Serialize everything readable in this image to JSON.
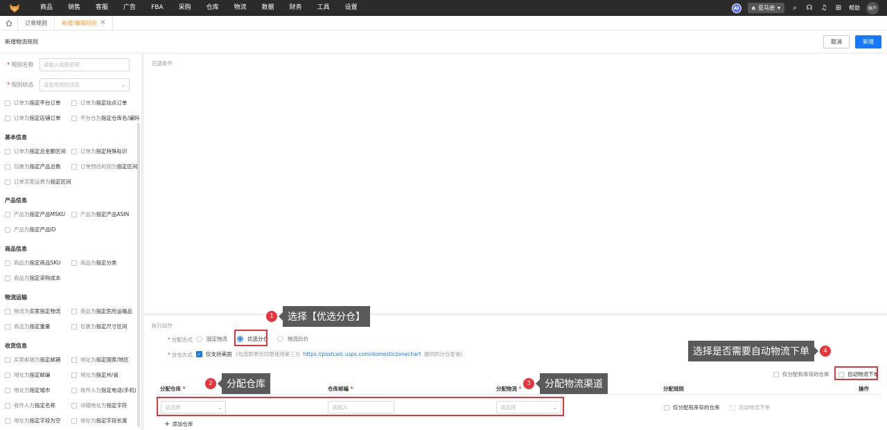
{
  "nav": {
    "items": [
      "商品",
      "销售",
      "客服",
      "广告",
      "FBA",
      "采购",
      "仓库",
      "物流",
      "数据",
      "财务",
      "工具",
      "设置"
    ],
    "ai_label": "AI",
    "store": "亚马逊",
    "help": "帮助",
    "account": "账户"
  },
  "tabs": {
    "tab1": "订单规则",
    "tab2": "新增/编辑规则"
  },
  "header": {
    "title": "新增物流规则",
    "cancel": "取消",
    "submit": "新增"
  },
  "sidebar": {
    "rule_name_label": "规则名称",
    "rule_name_placeholder": "请输入规则名称",
    "rule_status_label": "规则状态",
    "rule_status_placeholder": "请选择规则状态",
    "top_conditions": [
      {
        "pre": "订单为",
        "hl": "指定平台订单"
      },
      {
        "pre": "订单为",
        "hl": "指定站点订单"
      },
      {
        "pre": "订单为",
        "hl": "指定店铺订单"
      },
      {
        "pre": "平台仓为",
        "hl": "指定仓库名/编码"
      }
    ],
    "sections": [
      {
        "title": "基本信息",
        "items": [
          {
            "pre": "订单为",
            "hl": "指定总金额区间"
          },
          {
            "pre": "订单为",
            "hl": "指定特殊标识"
          },
          {
            "pre": "包裹为",
            "hl": "指定产品总数"
          },
          {
            "pre": "订单预估利润为",
            "hl": "指定区间"
          },
          {
            "pre": "订单买家运费为",
            "hl": "指定区间"
          }
        ]
      },
      {
        "title": "产品信息",
        "items": [
          {
            "pre": "产品为",
            "hl": "指定产品MSKU"
          },
          {
            "pre": "产品为",
            "hl": "指定产品ASIN"
          },
          {
            "pre": "产品为",
            "hl": "指定产品ID"
          }
        ]
      },
      {
        "title": "商品信息",
        "items": [
          {
            "pre": "商品为",
            "hl": "指定商品SKU"
          },
          {
            "pre": "商品为",
            "hl": "指定分类"
          },
          {
            "pre": "商品为",
            "hl": "指定采购成本"
          }
        ]
      },
      {
        "title": "物流运输",
        "items": [
          {
            "pre": "物流为",
            "hl": "买家指定物流"
          },
          {
            "pre": "商品为",
            "hl": "指定危险运输品"
          },
          {
            "pre": "商品为",
            "hl": "指定重量"
          },
          {
            "pre": "包裹为",
            "hl": "指定尺寸区间"
          }
        ]
      },
      {
        "title": "收货信息",
        "items": [
          {
            "pre": "买家邮箱为",
            "hl": "指定邮箱"
          },
          {
            "pre": "地址为",
            "hl": "指定国家/地区"
          },
          {
            "pre": "地址为",
            "hl": "指定邮编"
          },
          {
            "pre": "地址为",
            "hl": "指定州/省"
          },
          {
            "pre": "地址为",
            "hl": "指定城市"
          },
          {
            "pre": "收件人为",
            "hl": "指定电话(手机)"
          },
          {
            "pre": "收件人为",
            "hl": "指定名称"
          },
          {
            "pre": "详细地址为",
            "hl": "指定字符"
          },
          {
            "pre": "地址为",
            "hl": "指定字段为空"
          },
          {
            "pre": "地址为",
            "hl": "指定字段长度"
          }
        ]
      }
    ]
  },
  "main": {
    "selected_conditions": "已选条件",
    "exec_title": "执行动作",
    "alloc_mode_label": "分配方式",
    "alloc_options": [
      "固定物流",
      "优选分仓",
      "物流比价"
    ],
    "split_mode_label": "分仓方式",
    "split_option": "仅支持美国",
    "split_note_pre": "(勾选即表示同意使用第三方",
    "split_link": "https://postcalc.usps.com/domesticzonechart",
    "split_note_post": "提供的分仓查询)",
    "only_stock_label": "仅分配有库存的仓库",
    "auto_order_label": "自动物流下单",
    "columns": [
      "分配仓库",
      "仓库邮编",
      "分配物流",
      "分配规则",
      "操作"
    ],
    "row": {
      "warehouse_placeholder": "请选择",
      "zip_placeholder": "请输入",
      "logistics_placeholder": "请选择",
      "only_stock": "仅分配有库存的仓库",
      "auto_order": "自动物流下单"
    },
    "add_warehouse": "添加仓库"
  },
  "callouts": [
    {
      "num": "1",
      "text": "选择【优选分仓】"
    },
    {
      "num": "2",
      "text": "分配仓库"
    },
    {
      "num": "3",
      "text": "分配物流渠道"
    },
    {
      "num": "4",
      "text": "选择是否需要自动物流下单"
    }
  ]
}
